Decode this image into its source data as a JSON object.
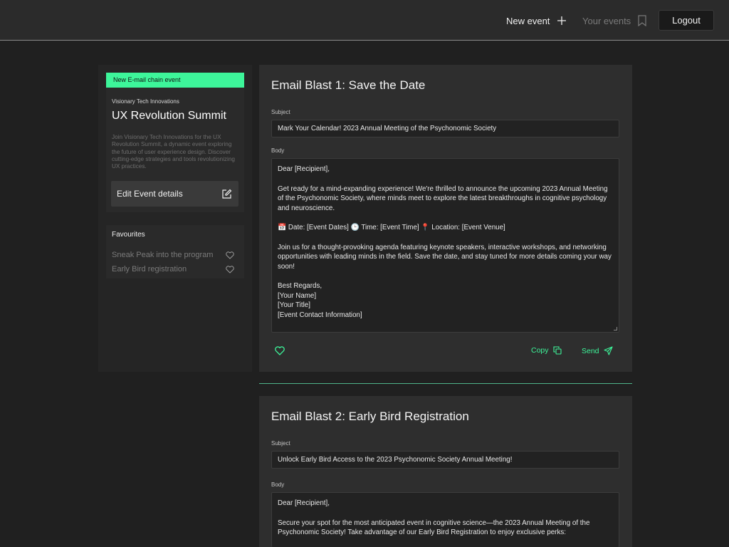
{
  "header": {
    "new_event_label": "New event",
    "your_events_label": "Your events",
    "logout_label": "Logout"
  },
  "sidebar": {
    "badge": "New E-mail chain event",
    "organizer": "Visionary Tech Innovations",
    "event_title": "UX Revolution Summit",
    "event_description": "Join Visionary  Tech Innovations for the UX Revolution Summit, a dynamic event exploring the future of user experience design. Discover cutting-edge strategies and tools revolutionizing UX practices.",
    "edit_label": "Edit Event details",
    "favourites_title": "Favourites",
    "favourites": [
      {
        "label": "Sneak Peak into the program"
      },
      {
        "label": "Early Bird registration"
      }
    ]
  },
  "blasts": [
    {
      "title": "Email Blast 1: Save the Date",
      "subject_label": "Subject",
      "subject": "Mark Your Calendar! 2023 Annual Meeting of the Psychonomic Society",
      "body_label": "Body",
      "body": [
        "Dear [Recipient],",
        "Get ready for a mind-expanding experience! We're thrilled to announce the upcoming 2023 Annual Meeting of the Psychonomic Society, where minds meet to explore the latest breakthroughs in cognitive psychology and neuroscience.",
        "📅 Date: [Event Dates] 🕒 Time: [Event Time] 📍 Location: [Event Venue]",
        "Join us for a thought-provoking agenda featuring keynote speakers, interactive workshops, and networking opportunities with leading minds in the field. Save the date, and stay tuned for more details coming your way soon!",
        "Best Regards,",
        "[Your Name]",
        "[Your Title]",
        "[Event Contact Information]"
      ],
      "copy_label": "Copy",
      "send_label": "Send"
    },
    {
      "title": "Email Blast 2: Early Bird Registration",
      "subject_label": "Subject",
      "subject": "Unlock Early Bird Access to the 2023 Psychonomic Society Annual Meeting!",
      "body_label": "Body",
      "body": [
        "Dear [Recipient],",
        "Secure your spot for the most anticipated event in cognitive science—the 2023 Annual Meeting of the Psychonomic Society! Take advantage of our Early Bird Registration to enjoy exclusive perks:"
      ]
    }
  ],
  "colors": {
    "accent": "#3df59a",
    "background": "#202020",
    "card": "#2e2e2e"
  },
  "icons": {
    "new_event": "plus-icon",
    "your_events": "bookmark-icon",
    "edit": "edit-icon",
    "favourite": "heart-icon",
    "copy": "copy-icon",
    "send": "send-icon"
  }
}
